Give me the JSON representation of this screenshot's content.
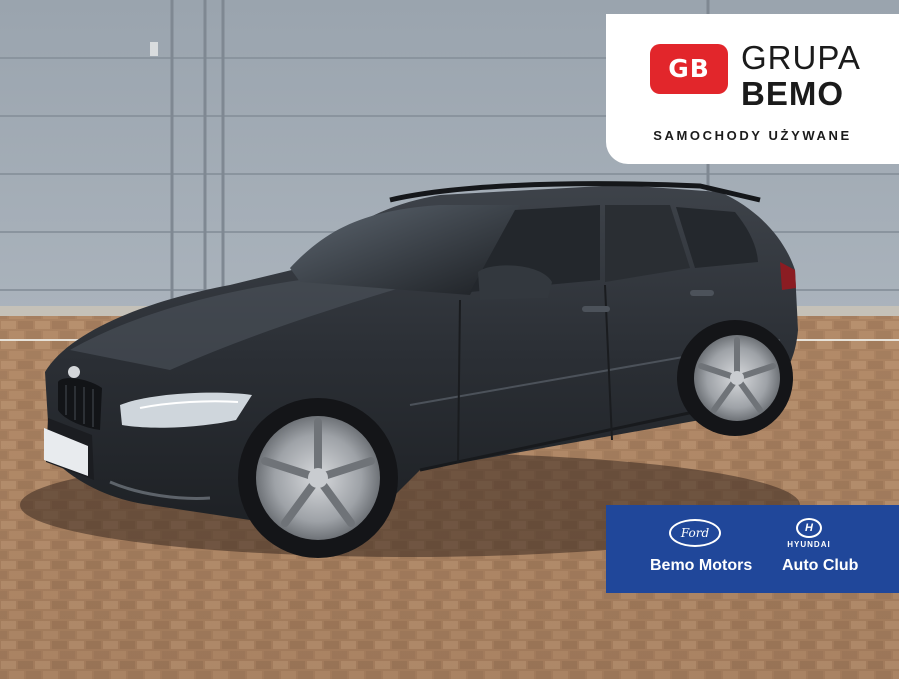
{
  "brand": {
    "logo_text": "GB",
    "name_line1": "GRUPA",
    "name_line2": "BEMO",
    "tagline": "SAMOCHODY UŻYWANE",
    "accent_color": "#e2262b"
  },
  "dealers": {
    "background_color": "#20479a",
    "items": [
      {
        "logo_text": "Ford",
        "name": "Bemo Motors"
      },
      {
        "logo_text": "H",
        "logo_word": "HYUNDAI",
        "name": "Auto Club"
      }
    ]
  },
  "photo": {
    "subject": "car-photo",
    "car_color": "#2f3338"
  }
}
